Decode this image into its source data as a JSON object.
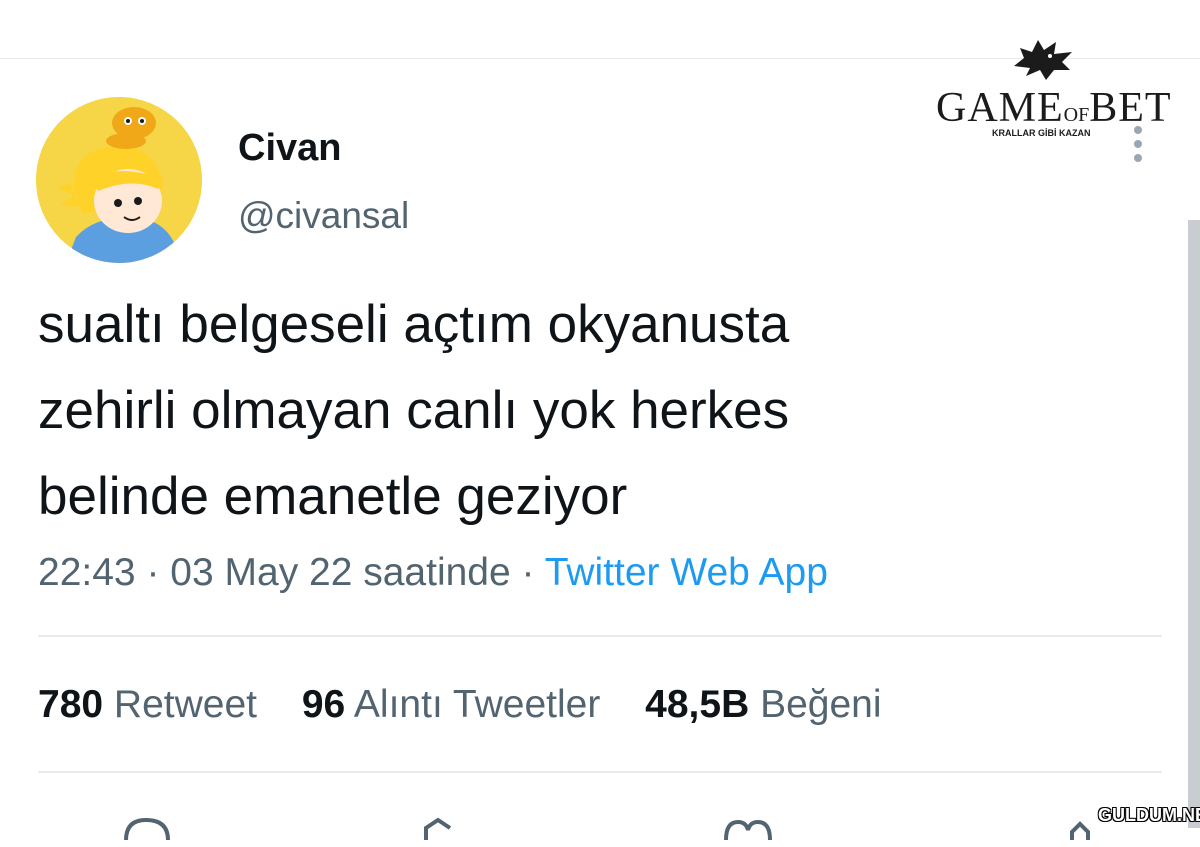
{
  "tweet": {
    "author": {
      "name": "Civan",
      "handle": "@civansal",
      "avatar_icon": "cartoon-avatar-icon"
    },
    "text_lines": [
      "sualtı belgeseli açtım okyanusta",
      "zehirli olmayan canlı yok herkes",
      "belinde emanetle geziyor"
    ],
    "time": "22:43",
    "date": "03 May 22 saatinde",
    "separator": "·",
    "source": "Twitter Web App",
    "stats": [
      {
        "count": "780",
        "label": "Retweet"
      },
      {
        "count": "96",
        "label": "Alıntı Tweetler"
      },
      {
        "count": "48,5B",
        "label": "Beğeni"
      }
    ],
    "actions": [
      "reply-icon",
      "retweet-icon",
      "like-icon",
      "share-icon"
    ]
  },
  "overlay": {
    "logo_text_game": "GAME",
    "logo_text_of": "OF",
    "logo_text_bet": "BET",
    "logo_tagline": "KRALLAR GİBİ KAZAN",
    "watermark": "GULDUM.NET"
  },
  "colors": {
    "text": "#0f1419",
    "secondary": "#536471",
    "link": "#1d9bf0",
    "divider": "#e6ecf0"
  }
}
